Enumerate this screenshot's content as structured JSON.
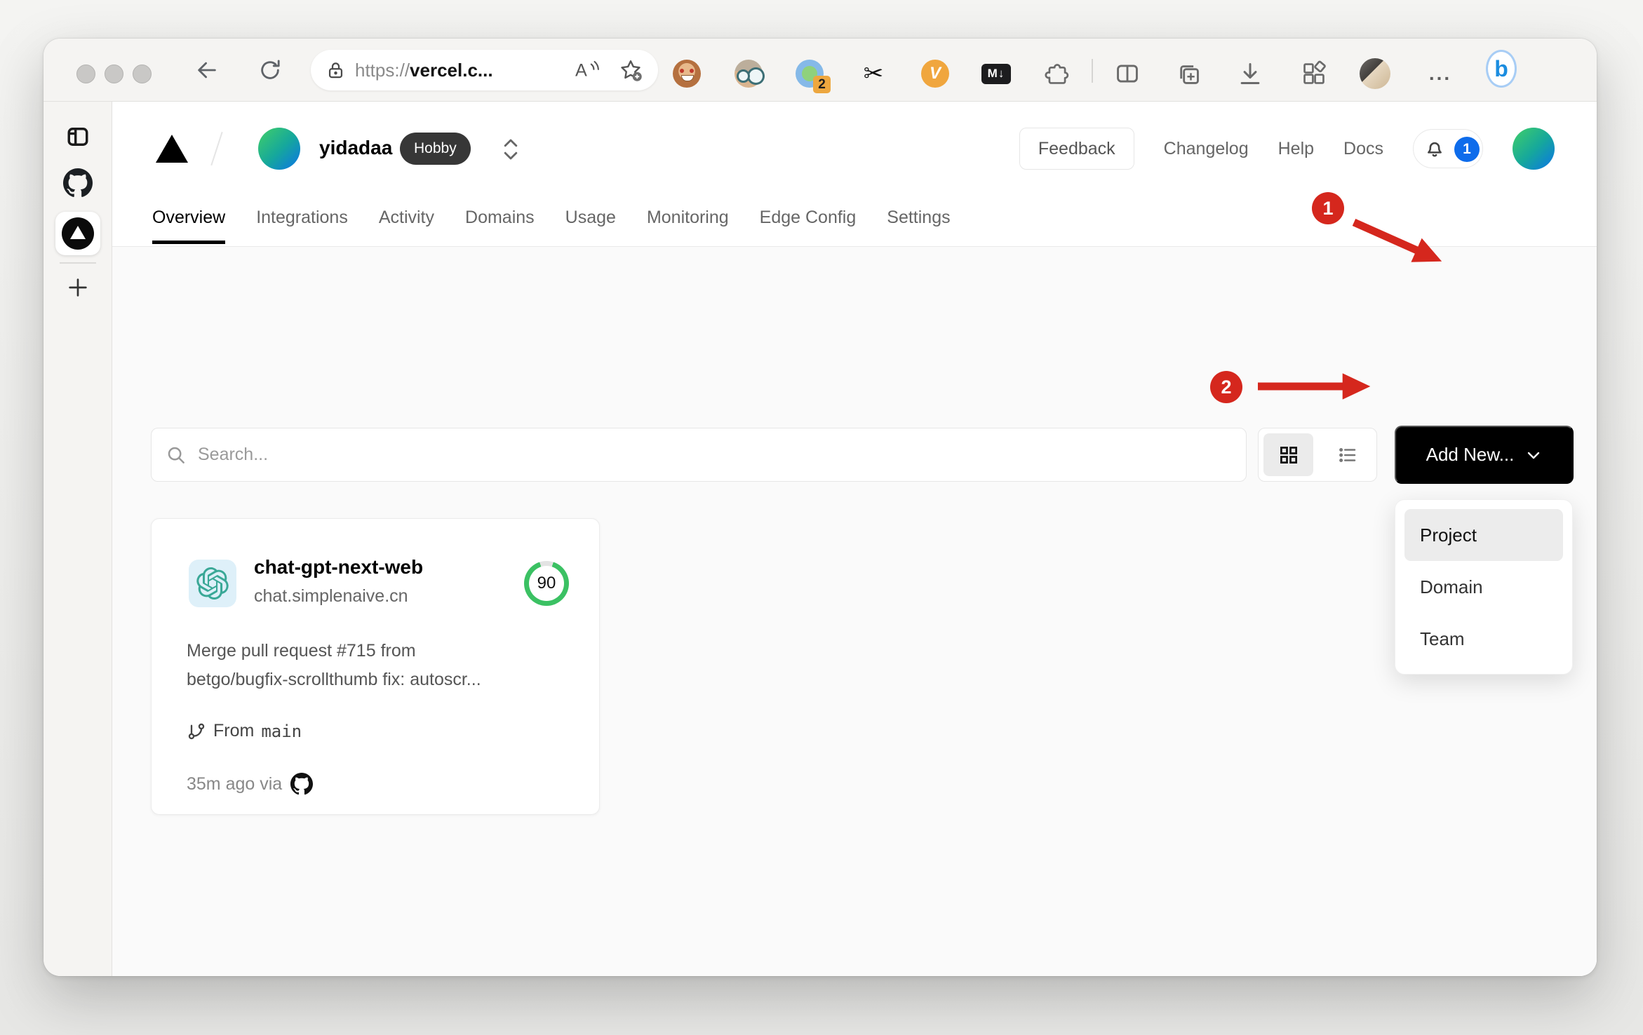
{
  "browser": {
    "url": {
      "scheme": "https://",
      "host": "vercel.c..."
    },
    "extensions": {
      "badge_count": "2",
      "scissors_glyph": "✂",
      "v_label": "V",
      "markdown_label": "M↓"
    },
    "more_label": "...",
    "bing_label": "b"
  },
  "header": {
    "team_name": "yidadaa",
    "plan_badge": "Hobby",
    "feedback_label": "Feedback",
    "links": [
      "Changelog",
      "Help",
      "Docs"
    ],
    "notification_count": "1"
  },
  "nav": {
    "tabs": [
      "Overview",
      "Integrations",
      "Activity",
      "Domains",
      "Usage",
      "Monitoring",
      "Edge Config",
      "Settings"
    ],
    "active_tab": "Overview"
  },
  "controls": {
    "search_placeholder": "Search...",
    "add_new_label": "Add New..."
  },
  "dropdown": {
    "items": [
      "Project",
      "Domain",
      "Team"
    ],
    "active_item": "Project"
  },
  "project": {
    "name": "chat-gpt-next-web",
    "domain": "chat.simplenaive.cn",
    "score": "90",
    "commit_line_1": "Merge pull request #715 from",
    "commit_line_2": "betgo/bugfix-scrollthumb fix: autoscr...",
    "branch_label": "From",
    "branch_name": "main",
    "deployed_meta": "35m ago via"
  },
  "annotations": {
    "step_1": "1",
    "step_2": "2"
  },
  "colors": {
    "annotation_red": "#d5271d",
    "score_green": "#3bc163",
    "notification_blue": "#0e6ceb",
    "add_button_black": "#000000",
    "plan_pill_dark": "#373737",
    "content_bg": "#fafafa"
  }
}
